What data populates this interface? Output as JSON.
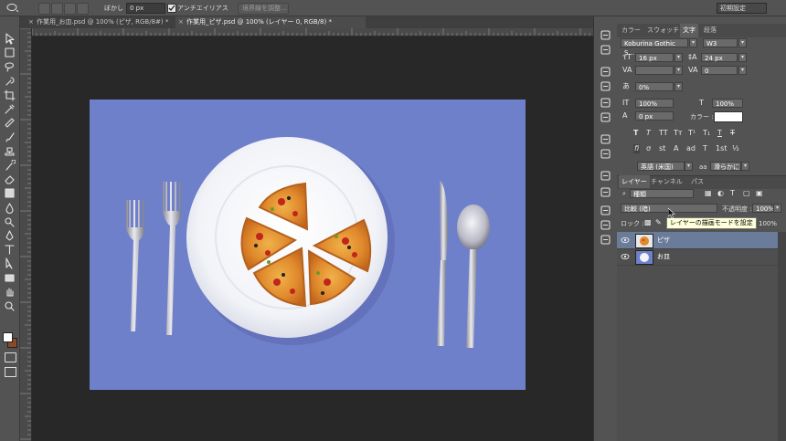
{
  "options_bar": {
    "blur_label": "ぼかし :",
    "blur_value": "0 px",
    "antialias_label": "アンチエイリアス",
    "refine_edge_button": "境界線を調整...",
    "workspace_selector": "初期設定"
  },
  "tabs": [
    {
      "label": "作業用_お皿.psd @ 100% (ピザ, RGB/8#) *",
      "active": false
    },
    {
      "label": "作業用_ピザ.psd @ 100% (レイヤー 0, RGB/8) *",
      "active": true
    }
  ],
  "char_panel": {
    "tabs": [
      "カラー",
      "スウォッチ",
      "文字",
      "段落"
    ],
    "active_tab": "文字",
    "font_family": "Koburina Gothic S...",
    "font_weight": "W3",
    "font_size": "16 px",
    "leading": "24 px",
    "kerning": "",
    "tracking": "0",
    "tsume": "0%",
    "vertical_scale": "100%",
    "horizontal_scale": "100%",
    "baseline_shift": "0 px",
    "color_label": "カラー :",
    "type_buttons": [
      "T",
      "T",
      "TT",
      "Tт",
      "T¹",
      "T₁",
      "T",
      "T"
    ],
    "opentype_buttons": [
      "fi",
      "ơ",
      "st",
      "A",
      "ad",
      "T",
      "1st",
      "½"
    ],
    "language": "英語 (米国)",
    "antialias": "滑らかに"
  },
  "layers_panel": {
    "tabs": [
      "レイヤー",
      "チャンネル",
      "パス"
    ],
    "active_tab": "レイヤー",
    "filter_kind": "種類",
    "blend_mode": "比較 (暗)",
    "opacity_label": "不透明度 :",
    "opacity_value": "100%",
    "lock_label": "ロック :",
    "fill_value": "100%",
    "layers": [
      {
        "name": "ピザ",
        "selected": true
      },
      {
        "name": "お皿",
        "selected": false
      }
    ]
  },
  "tooltip": "レイヤーの描画モードを設定",
  "colors": {
    "ui_bg": "#535353",
    "canvas_bg": "#282828",
    "tablecloth": "#6f7fc9",
    "selected_layer": "#6a7c9a"
  },
  "icons": {
    "tools": [
      "move-icon",
      "marquee-icon",
      "lasso-icon",
      "quick-select-icon",
      "crop-icon",
      "eyedropper-icon",
      "healing-brush-icon",
      "brush-icon",
      "stamp-icon",
      "history-brush-icon",
      "eraser-icon",
      "gradient-icon",
      "blur-icon",
      "dodge-icon",
      "pen-icon",
      "type-icon",
      "path-select-icon",
      "shape-icon",
      "hand-icon",
      "zoom-icon"
    ]
  }
}
